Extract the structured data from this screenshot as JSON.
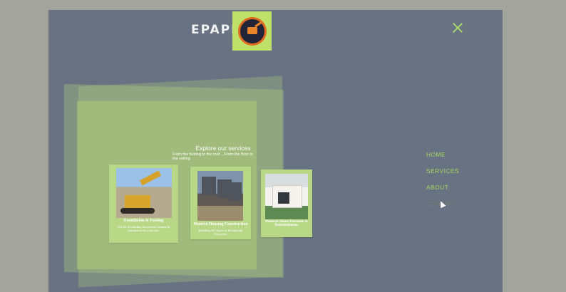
{
  "brand": {
    "name": "EPAPE",
    "logo_icon": "excavator-logo-icon"
  },
  "header": {
    "close_icon": "close-icon"
  },
  "services": {
    "title": "Explore our services",
    "subtitle": "From the footing to the roof ...From the floor to the ceiling",
    "cards": [
      {
        "title": "Foundation & Footing",
        "desc": "The #1 in building the perfect footing & foundation for your site."
      },
      {
        "title": "Modern Housing Construction",
        "desc": "Building All Types of Residential Properties"
      },
      {
        "title": "Domestic House Extension & Refurbishments",
        "desc": ""
      }
    ]
  },
  "nav": {
    "items": [
      "HOME",
      "SERVICES",
      "ABOUT",
      "CONTACT"
    ]
  },
  "colors": {
    "accent": "#a6d65f",
    "panel": "#687283",
    "card": "#b8d888"
  }
}
